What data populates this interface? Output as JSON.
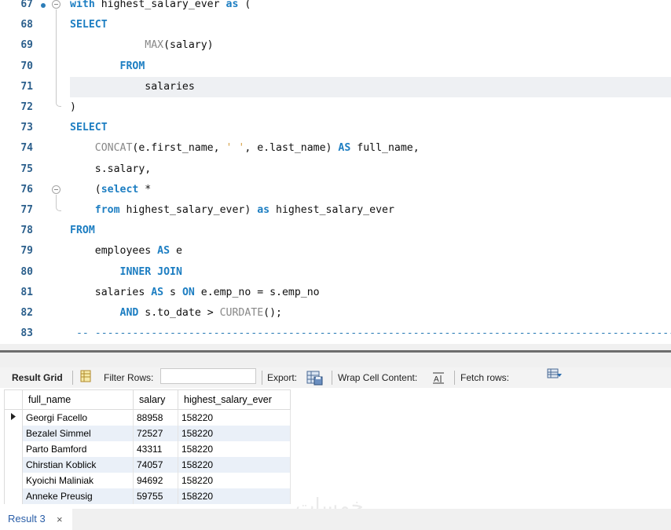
{
  "editor": {
    "lines": [
      {
        "num": "67",
        "tokens": [
          [
            "kw",
            "with"
          ],
          [
            "p",
            " highest_salary_ever "
          ],
          [
            "kw",
            "as"
          ],
          [
            "p",
            " ("
          ]
        ]
      },
      {
        "num": "68",
        "tokens": [
          [
            "kw",
            "SELECT"
          ]
        ]
      },
      {
        "num": "69",
        "tokens": [
          [
            "p",
            "            "
          ],
          [
            "fn",
            "MAX"
          ],
          [
            "p",
            "(salary)"
          ]
        ]
      },
      {
        "num": "70",
        "tokens": [
          [
            "p",
            "        "
          ],
          [
            "kw",
            "FROM"
          ]
        ]
      },
      {
        "num": "71",
        "tokens": [
          [
            "p",
            "            salaries"
          ]
        ]
      },
      {
        "num": "72",
        "tokens": [
          [
            "p",
            ")"
          ]
        ]
      },
      {
        "num": "73",
        "tokens": [
          [
            "kw",
            "SELECT"
          ]
        ]
      },
      {
        "num": "74",
        "tokens": [
          [
            "p",
            "    "
          ],
          [
            "fn",
            "CONCAT"
          ],
          [
            "p",
            "(e.first_name, "
          ],
          [
            "str",
            "' '"
          ],
          [
            "p",
            ", e.last_name) "
          ],
          [
            "kw",
            "AS"
          ],
          [
            "p",
            " full_name,"
          ]
        ]
      },
      {
        "num": "75",
        "tokens": [
          [
            "p",
            "    s.salary,"
          ]
        ]
      },
      {
        "num": "76",
        "tokens": [
          [
            "p",
            "    ("
          ],
          [
            "kw",
            "select"
          ],
          [
            "p",
            " *"
          ]
        ]
      },
      {
        "num": "77",
        "tokens": [
          [
            "p",
            "    "
          ],
          [
            "kw",
            "from"
          ],
          [
            "p",
            " highest_salary_ever) "
          ],
          [
            "kw",
            "as"
          ],
          [
            "p",
            " highest_salary_ever"
          ]
        ]
      },
      {
        "num": "78",
        "tokens": [
          [
            "kw",
            "FROM"
          ]
        ]
      },
      {
        "num": "79",
        "tokens": [
          [
            "p",
            "    employees "
          ],
          [
            "kw",
            "AS"
          ],
          [
            "p",
            " e"
          ]
        ]
      },
      {
        "num": "80",
        "tokens": [
          [
            "p",
            "        "
          ],
          [
            "kw",
            "INNER JOIN"
          ]
        ]
      },
      {
        "num": "81",
        "tokens": [
          [
            "p",
            "    salaries "
          ],
          [
            "kw",
            "AS"
          ],
          [
            "p",
            " s "
          ],
          [
            "kw",
            "ON"
          ],
          [
            "p",
            " e.emp_no = s.emp_no"
          ]
        ]
      },
      {
        "num": "82",
        "tokens": [
          [
            "p",
            "        "
          ],
          [
            "kw",
            "AND"
          ],
          [
            "p",
            " s.to_date > "
          ],
          [
            "fn",
            "CURDATE"
          ],
          [
            "p",
            "();"
          ]
        ]
      },
      {
        "num": "83",
        "tokens": [
          [
            "cm",
            " -- ---------------------------------------------------------------------------------------------------------"
          ]
        ]
      }
    ]
  },
  "toolbar": {
    "result_grid": "Result Grid",
    "filter_rows": "Filter Rows:",
    "filter_value": "",
    "export": "Export:",
    "wrap": "Wrap Cell Content:",
    "fetch": "Fetch rows:"
  },
  "grid": {
    "columns": [
      "full_name",
      "salary",
      "highest_salary_ever"
    ],
    "rows": [
      [
        "Georgi Facello",
        "88958",
        "158220"
      ],
      [
        "Bezalel Simmel",
        "72527",
        "158220"
      ],
      [
        "Parto Bamford",
        "43311",
        "158220"
      ],
      [
        "Chirstian Koblick",
        "74057",
        "158220"
      ],
      [
        "Kyoichi Maliniak",
        "94692",
        "158220"
      ],
      [
        "Anneke Preusig",
        "59755",
        "158220"
      ]
    ]
  },
  "tabs": {
    "result_tab": "Result 3",
    "close": "×"
  },
  "watermark": "خمسات",
  "colors": {
    "keyword": "#1d7ec2",
    "function": "#888888",
    "string": "#d6a24a",
    "line_number": "#2b5f8c"
  }
}
